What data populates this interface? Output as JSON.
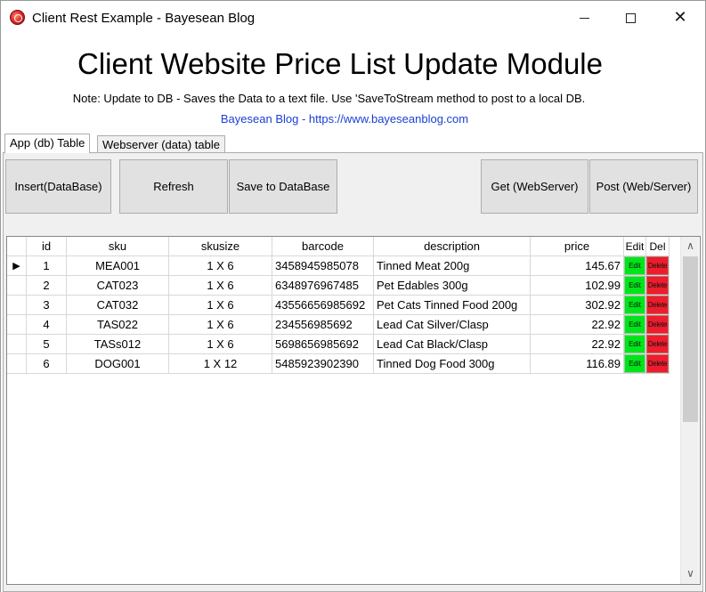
{
  "window": {
    "title": "Client Rest Example - Bayesean Blog",
    "controls": {
      "minimize": "minimize",
      "maximize": "maximize",
      "close": "✕"
    }
  },
  "header": {
    "heading": "Client Website Price List Update Module",
    "note": "Note: Update to DB -  Saves the Data to a text file. Use 'SaveToStream method to post to a local DB.",
    "link": "Bayesean Blog - https://www.bayeseanblog.com"
  },
  "tabs": [
    {
      "label": "App (db) Table",
      "active": true
    },
    {
      "label": "Webserver (data) table",
      "active": false
    }
  ],
  "toolbar": {
    "insert": "Insert(DataBase)",
    "refresh": "Refresh",
    "save": "Save to DataBase",
    "get": "Get  (WebServer)",
    "post": "Post (Web/Server)"
  },
  "grid": {
    "columns": [
      "id",
      "sku",
      "skusize",
      "barcode",
      "description",
      "price",
      "Edit",
      "Del"
    ],
    "current_row_indicator": "▶",
    "edit_label": "Edit",
    "delete_label": "Delete",
    "rows": [
      {
        "id": "1",
        "sku": "MEA001",
        "skusize": "1 X 6",
        "barcode": "3458945985078",
        "description": "Tinned Meat 200g",
        "price": "145.67"
      },
      {
        "id": "2",
        "sku": "CAT023",
        "skusize": "1 X 6",
        "barcode": "6348976967485",
        "description": "Pet Edables 300g",
        "price": "102.99"
      },
      {
        "id": "3",
        "sku": "CAT032",
        "skusize": "1 X 6",
        "barcode": "43556656985692",
        "description": "Pet Cats Tinned Food 200g",
        "price": "302.92"
      },
      {
        "id": "4",
        "sku": "TAS022",
        "skusize": "1 X 6",
        "barcode": "234556985692",
        "description": "Lead Cat Silver/Clasp",
        "price": "22.92"
      },
      {
        "id": "5",
        "sku": "TASs012",
        "skusize": "1 X 6",
        "barcode": "5698656985692",
        "description": "Lead Cat Black/Clasp",
        "price": "22.92"
      },
      {
        "id": "6",
        "sku": "DOG001",
        "skusize": "1 X 12",
        "barcode": "5485923902390",
        "description": "Tinned Dog Food 300g",
        "price": "116.89"
      }
    ]
  },
  "scrollbar": {
    "up": "∧",
    "down": "∨"
  },
  "colors": {
    "edit": "#00e51a",
    "delete": "#ec1d2c",
    "link": "#1a3fd6"
  }
}
